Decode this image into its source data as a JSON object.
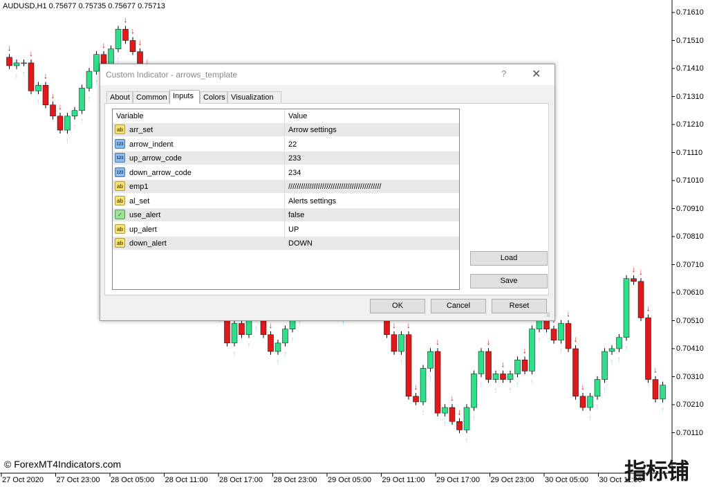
{
  "chart": {
    "symbol_info": "AUDUSD,H1  0.75677 0.75735 0.75677 0.75713",
    "copyright": "© ForexMT4Indicators.com",
    "watermark": "指标铺",
    "price_labels": [
      "0.71610",
      "0.71510",
      "0.71410",
      "0.71310",
      "0.71210",
      "0.71110",
      "0.71010",
      "0.70910",
      "0.70810",
      "0.70710",
      "0.70610",
      "0.70510",
      "0.70410",
      "0.70310",
      "0.70210",
      "0.70110"
    ],
    "time_labels": [
      "27 Oct 2020",
      "27 Oct 23:00",
      "28 Oct 05:00",
      "28 Oct 11:00",
      "28 Oct 17:00",
      "28 Oct 23:00",
      "29 Oct 05:00",
      "29 Oct 11:00",
      "29 Oct 17:00",
      "29 Oct 23:00",
      "30 Oct 05:00",
      "30 Oct 11:00"
    ],
    "colors": {
      "bull": "#2fe08a",
      "bear": "#e01a1a",
      "up_arrow": "#a8d4e6",
      "down_arrow": "#d01010",
      "wick": "#000000"
    }
  },
  "dialog": {
    "title": "Custom Indicator - arrows_template",
    "help": "?",
    "close": "✕",
    "tabs": [
      {
        "label": "About",
        "active": false
      },
      {
        "label": "Common",
        "active": false
      },
      {
        "label": "Inputs",
        "active": true
      },
      {
        "label": "Colors",
        "active": false
      },
      {
        "label": "Visualization",
        "active": false
      }
    ],
    "headers": {
      "variable": "Variable",
      "value": "Value"
    },
    "rows": [
      {
        "type": "string",
        "variable": "arr_set",
        "value": "Arrow settings"
      },
      {
        "type": "int",
        "variable": "arrow_indent",
        "value": "22"
      },
      {
        "type": "int",
        "variable": "up_arrow_code",
        "value": "233"
      },
      {
        "type": "int",
        "variable": "down_arrow_code",
        "value": "234"
      },
      {
        "type": "string",
        "variable": "emp1",
        "value": "////////////////////////////////////////////"
      },
      {
        "type": "string",
        "variable": "al_set",
        "value": "Alerts settings"
      },
      {
        "type": "bool",
        "variable": "use_alert",
        "value": "false"
      },
      {
        "type": "string",
        "variable": "up_alert",
        "value": "UP"
      },
      {
        "type": "string",
        "variable": "down_alert",
        "value": "DOWN"
      }
    ],
    "icon_text": {
      "string": "ab",
      "int": "123",
      "bool": "✓"
    },
    "buttons": {
      "load": "Load",
      "save": "Save",
      "ok": "OK",
      "cancel": "Cancel",
      "reset": "Reset"
    }
  }
}
